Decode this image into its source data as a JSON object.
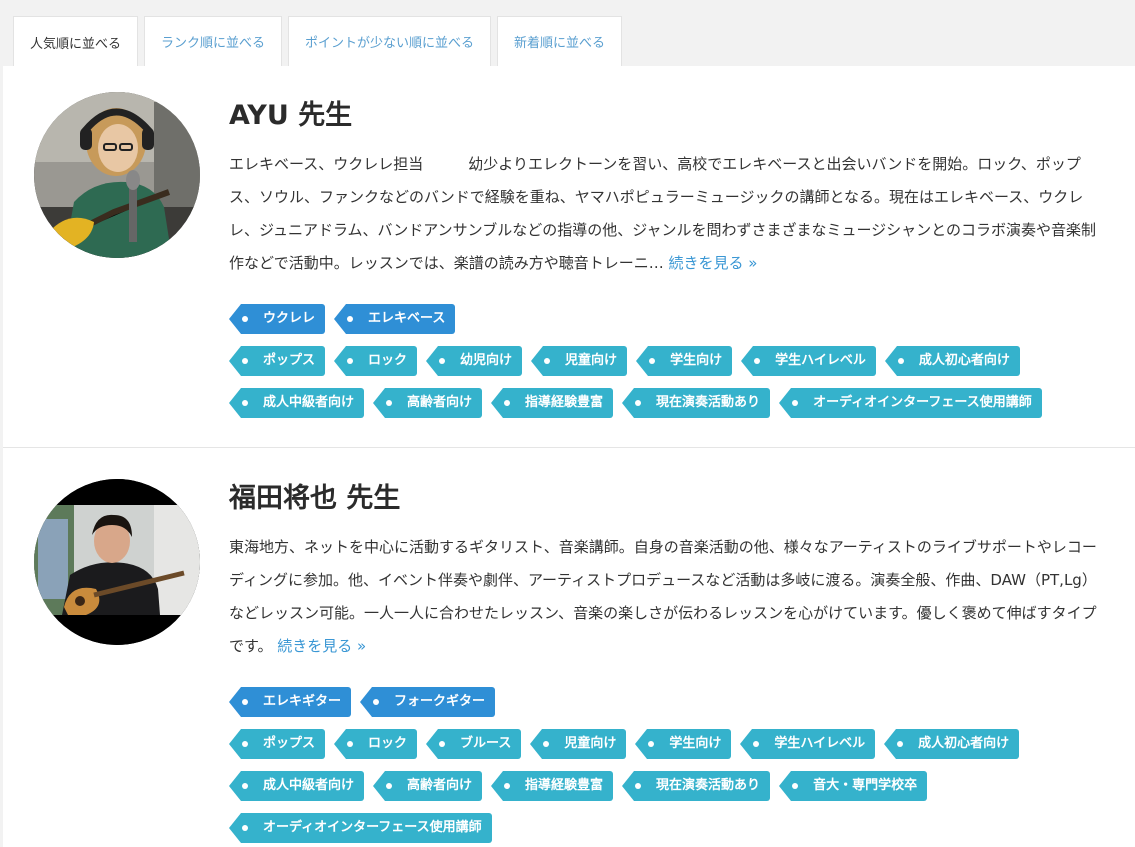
{
  "tabs": [
    {
      "label": "人気順に並べる",
      "active": true
    },
    {
      "label": "ランク順に並べる",
      "active": false
    },
    {
      "label": "ポイントが少ない順に並べる",
      "active": false
    },
    {
      "label": "新着順に並べる",
      "active": false
    }
  ],
  "teachers": [
    {
      "name": "AYU 先生",
      "description": "エレキベース、ウクレレ担当　　　幼少よりエレクトーンを習い、高校でエレキベースと出会いバンドを開始。ロック、ポップス、ソウル、ファンクなどのバンドで経験を重ね、ヤマハポピュラーミュージックの講師となる。現在はエレキベース、ウクレレ、ジュニアドラム、バンドアンサンブルなどの指導の他、ジャンルを問わずさまざまなミュージシャンとのコラボ演奏や音楽制作などで活動中。レッスンでは、楽譜の読み方や聴音トレーニ… ",
      "more_label": "続きを見る »",
      "instrument_tags": [
        "ウクレレ",
        "エレキベース"
      ],
      "tag_rows": [
        [
          "ポップス",
          "ロック",
          "幼児向け",
          "児童向け",
          "学生向け",
          "学生ハイレベル",
          "成人初心者向け"
        ],
        [
          "成人中級者向け",
          "高齢者向け",
          "指導経験豊富",
          "現在演奏活動あり",
          "オーディオインターフェース使用講師"
        ]
      ]
    },
    {
      "name": "福田将也 先生",
      "description": "東海地方、ネットを中心に活動するギタリスト、音楽講師。自身の音楽活動の他、様々なアーティストのライブサポートやレコーディングに参加。他、イベント伴奏や劇伴、アーティストプロデュースなど活動は多岐に渡る。演奏全般、作曲、DAW（PT,Lg）などレッスン可能。一人一人に合わせたレッスン、音楽の楽しさが伝わるレッスンを心がけています。優しく褒めて伸ばすタイプです。 ",
      "more_label": "続きを見る »",
      "instrument_tags": [
        "エレキギター",
        "フォークギター"
      ],
      "tag_rows": [
        [
          "ポップス",
          "ロック",
          "ブルース",
          "児童向け",
          "学生向け",
          "学生ハイレベル",
          "成人初心者向け"
        ],
        [
          "成人中級者向け",
          "高齢者向け",
          "指導経験豊富",
          "現在演奏活動あり",
          "音大・専門学校卒"
        ],
        [
          "オーディオインターフェース使用講師"
        ]
      ]
    }
  ]
}
